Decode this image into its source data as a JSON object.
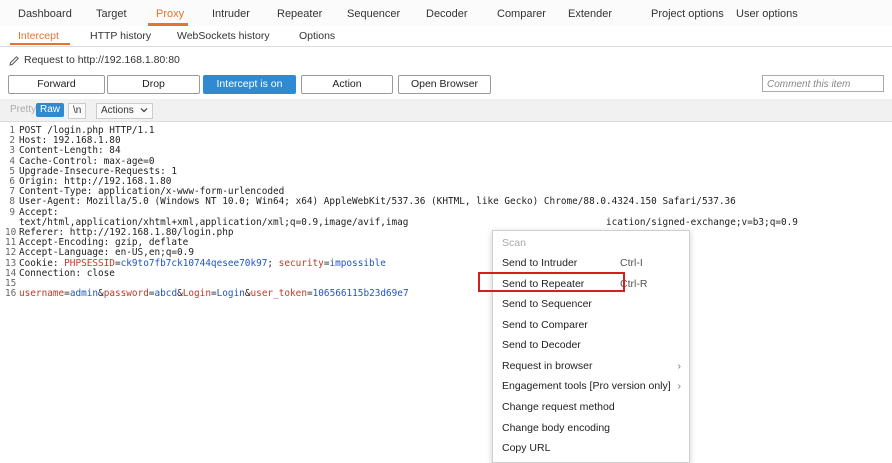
{
  "main_tabs": [
    "Dashboard",
    "Target",
    "Proxy",
    "Intruder",
    "Repeater",
    "Sequencer",
    "Decoder",
    "Comparer",
    "Extender",
    "Project options",
    "User options"
  ],
  "sub_tabs": [
    "Intercept",
    "HTTP history",
    "WebSockets history",
    "Options"
  ],
  "request_line": "Request to http://192.168.1.80:80",
  "buttons": {
    "forward": "Forward",
    "drop": "Drop",
    "intercept": "Intercept is on",
    "action": "Action",
    "open_browser": "Open Browser"
  },
  "comment_placeholder": "Comment this item",
  "view_toolbar": {
    "pretty": "Pretty",
    "raw": "Raw",
    "newline": "\\n",
    "actions": "Actions"
  },
  "editor_lines": [
    {
      "n": "1",
      "parts": [
        [
          "POST /login.php HTTP/1.1",
          "plain"
        ]
      ]
    },
    {
      "n": "2",
      "parts": [
        [
          "Host: 192.168.1.80",
          "plain"
        ]
      ]
    },
    {
      "n": "3",
      "parts": [
        [
          "Content-Length: 84",
          "plain"
        ]
      ]
    },
    {
      "n": "4",
      "parts": [
        [
          "Cache-Control: max-age=0",
          "plain"
        ]
      ]
    },
    {
      "n": "5",
      "parts": [
        [
          "Upgrade-Insecure-Requests: 1",
          "plain"
        ]
      ]
    },
    {
      "n": "6",
      "parts": [
        [
          "Origin: http://192.168.1.80",
          "plain"
        ]
      ]
    },
    {
      "n": "7",
      "parts": [
        [
          "Content-Type: application/x-www-form-urlencoded",
          "plain"
        ]
      ]
    },
    {
      "n": "8",
      "parts": [
        [
          "User-Agent: Mozilla/5.0 (Windows NT 10.0; Win64; x64) AppleWebKit/537.36 (KHTML, like Gecko) Chrome/88.0.4324.150 Safari/537.36",
          "plain"
        ]
      ]
    },
    {
      "n": "9",
      "parts": [
        [
          "Accept:",
          "plain"
        ]
      ]
    },
    {
      "n": "",
      "parts": [
        [
          "text/html,application/xhtml+xml,application/xml;q=0.9,image/avif,imag",
          "plain"
        ],
        [
          "                                   ",
          "plain"
        ],
        [
          "ication/signed-exchange;v=b3;q=0.9",
          "plain"
        ]
      ]
    },
    {
      "n": "10",
      "parts": [
        [
          "Referer: http://192.168.1.80/login.php",
          "plain"
        ]
      ]
    },
    {
      "n": "11",
      "parts": [
        [
          "Accept-Encoding: gzip, deflate",
          "plain"
        ]
      ]
    },
    {
      "n": "12",
      "parts": [
        [
          "Accept-Language: en-US,en;q=0.9",
          "plain"
        ]
      ]
    },
    {
      "n": "13",
      "parts": [
        [
          "Cookie: ",
          "plain"
        ],
        [
          "PHPSESSID",
          "red"
        ],
        [
          "=",
          "plain"
        ],
        [
          "ck9to7fb7ck10744qesee70k97",
          "blue"
        ],
        [
          "; ",
          "plain"
        ],
        [
          "security",
          "red"
        ],
        [
          "=",
          "plain"
        ],
        [
          "impossible",
          "blue"
        ]
      ]
    },
    {
      "n": "14",
      "parts": [
        [
          "Connection: close",
          "plain"
        ]
      ]
    },
    {
      "n": "15",
      "parts": [
        [
          "",
          "plain"
        ]
      ]
    },
    {
      "n": "16",
      "parts": [
        [
          "username",
          "red"
        ],
        [
          "=",
          "plain"
        ],
        [
          "admin",
          "blue"
        ],
        [
          "&",
          "plain"
        ],
        [
          "password",
          "red"
        ],
        [
          "=",
          "plain"
        ],
        [
          "abcd",
          "blue"
        ],
        [
          "&",
          "plain"
        ],
        [
          "Login",
          "red"
        ],
        [
          "=",
          "plain"
        ],
        [
          "Login",
          "blue"
        ],
        [
          "&",
          "plain"
        ],
        [
          "user_token",
          "red"
        ],
        [
          "=",
          "plain"
        ],
        [
          "106566115b23d69e7",
          "blue"
        ]
      ]
    }
  ],
  "context_menu": [
    {
      "label": "Scan",
      "shortcut": "",
      "submenu": false,
      "disabled": true
    },
    {
      "label": "Send to Intruder",
      "shortcut": "Ctrl-I",
      "submenu": false,
      "disabled": false
    },
    {
      "label": "Send to Repeater",
      "shortcut": "Ctrl-R",
      "submenu": false,
      "disabled": false
    },
    {
      "label": "Send to Sequencer",
      "shortcut": "",
      "submenu": false,
      "disabled": false
    },
    {
      "label": "Send to Comparer",
      "shortcut": "",
      "submenu": false,
      "disabled": false
    },
    {
      "label": "Send to Decoder",
      "shortcut": "",
      "submenu": false,
      "disabled": false
    },
    {
      "label": "Request in browser",
      "shortcut": "",
      "submenu": true,
      "disabled": false
    },
    {
      "label": "Engagement tools [Pro version only]",
      "shortcut": "",
      "submenu": true,
      "disabled": false
    },
    {
      "label": "Change request method",
      "shortcut": "",
      "submenu": false,
      "disabled": false
    },
    {
      "label": "Change body encoding",
      "shortcut": "",
      "submenu": false,
      "disabled": false
    },
    {
      "label": "Copy URL",
      "shortcut": "",
      "submenu": false,
      "disabled": false
    }
  ],
  "colors": {
    "accent": "#e8732c",
    "primary_button": "#2f8bd1",
    "highlight_box": "#d21f1f",
    "param_name": "#c0392b",
    "param_value": "#2155c4"
  },
  "icons": {
    "edit": "pencil-icon",
    "submenu": "chevron-right-icon",
    "actions": "chevron-down-icon"
  }
}
